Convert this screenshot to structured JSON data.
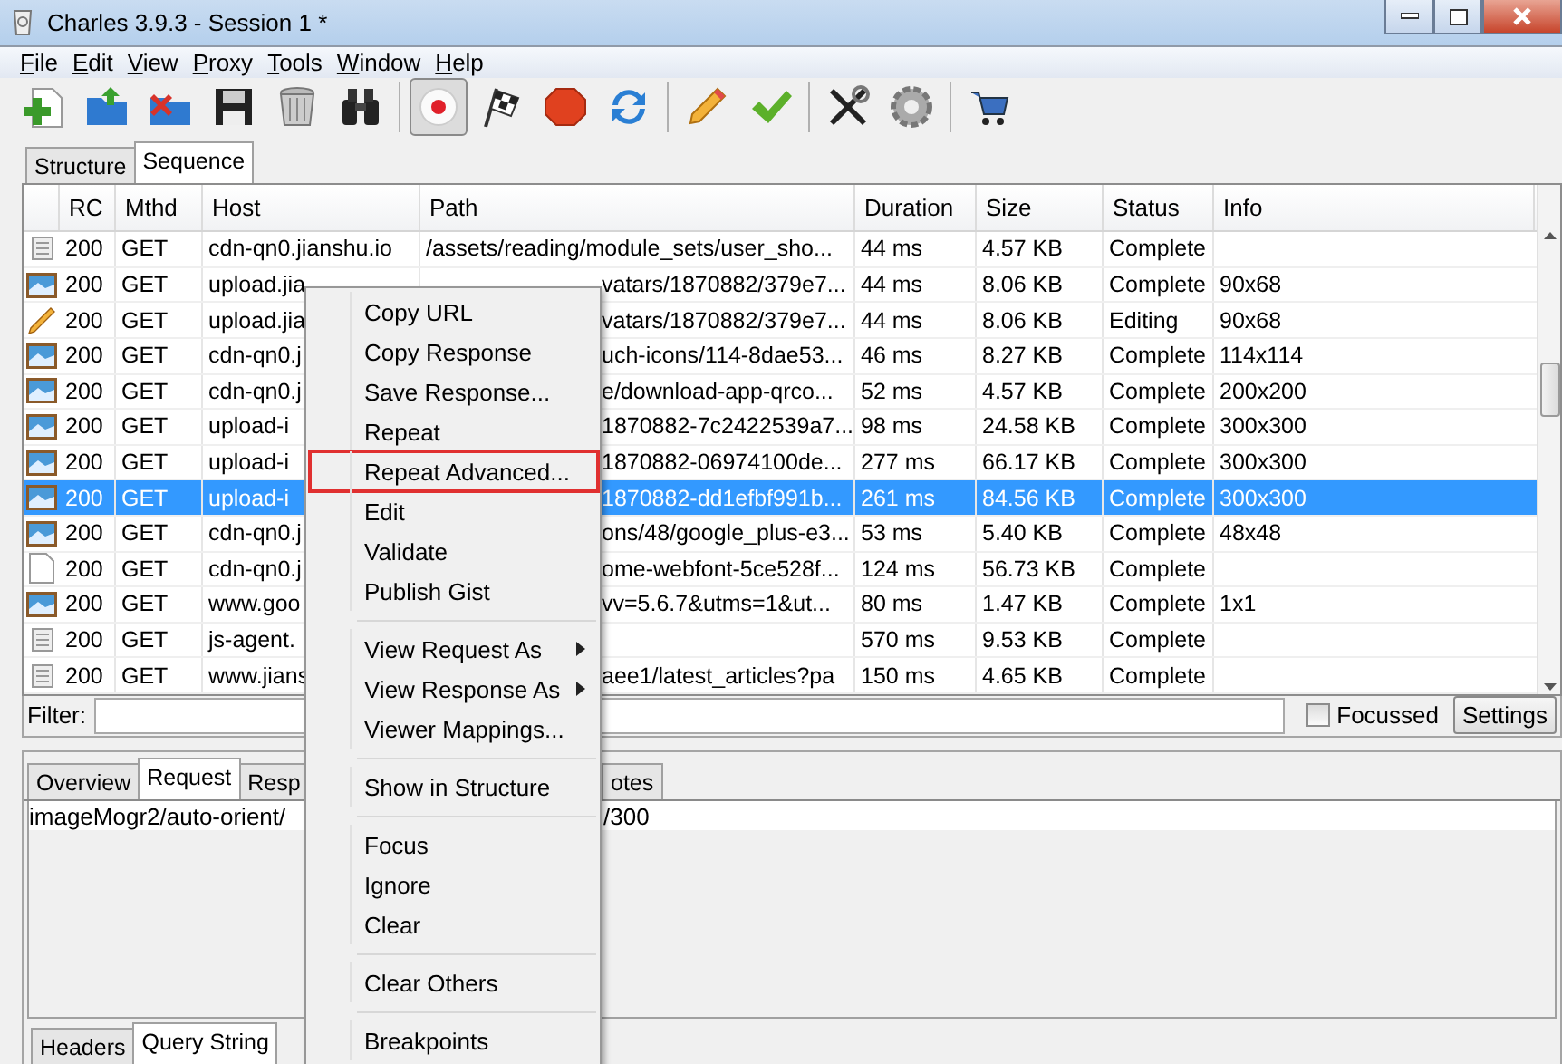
{
  "window": {
    "title": "Charles 3.9.3 - Session 1 *"
  },
  "menu_bar": [
    "File",
    "Edit",
    "View",
    "Proxy",
    "Tools",
    "Window",
    "Help"
  ],
  "toolbar": [
    {
      "kind": "new"
    },
    {
      "kind": "open"
    },
    {
      "kind": "close"
    },
    {
      "kind": "save"
    },
    {
      "kind": "trash"
    },
    {
      "kind": "find"
    },
    {
      "kind": "record",
      "pressed": true
    },
    {
      "kind": "flag",
      "pressed": false
    },
    {
      "kind": "stop",
      "pressed": false
    },
    {
      "kind": "repeat"
    },
    {
      "kind": "edit"
    },
    {
      "kind": "validate"
    },
    {
      "kind": "tools"
    },
    {
      "kind": "settings"
    },
    {
      "kind": "cart"
    }
  ],
  "view_tabs": [
    {
      "label": "Structure",
      "selected": false
    },
    {
      "label": "Sequence",
      "selected": true
    }
  ],
  "table": {
    "columns": [
      "RC",
      "Mthd",
      "Host",
      "Path",
      "Duration",
      "Size",
      "Status",
      "Info"
    ],
    "rows": [
      {
        "kind": "script",
        "rc": "200",
        "method": "GET",
        "host": "cdn-qn0.jianshu.io",
        "path": "/assets/reading/module_sets/user_sho...",
        "duration": "44 ms",
        "size": "4.57 KB",
        "status": "Complete",
        "info": "",
        "selected": false
      },
      {
        "kind": "image",
        "rc": "200",
        "method": "GET",
        "host": "upload.jia",
        "path": "vatars/1870882/379e7...",
        "duration": "44 ms",
        "size": "8.06 KB",
        "status": "Complete",
        "info": "90x68",
        "selected": false
      },
      {
        "kind": "edit",
        "rc": "200",
        "method": "GET",
        "host": "upload.jia",
        "path": "vatars/1870882/379e7...",
        "duration": "44 ms",
        "size": "8.06 KB",
        "status": "Editing",
        "info": "90x68",
        "selected": false
      },
      {
        "kind": "image",
        "rc": "200",
        "method": "GET",
        "host": "cdn-qn0.j",
        "path": "uch-icons/114-8dae53...",
        "duration": "46 ms",
        "size": "8.27 KB",
        "status": "Complete",
        "info": "114x114",
        "selected": false
      },
      {
        "kind": "image",
        "rc": "200",
        "method": "GET",
        "host": "cdn-qn0.j",
        "path": "e/download-app-qrco...",
        "duration": "52 ms",
        "size": "4.57 KB",
        "status": "Complete",
        "info": "200x200",
        "selected": false
      },
      {
        "kind": "image",
        "rc": "200",
        "method": "GET",
        "host": "upload-i",
        "path": "1870882-7c2422539a7...",
        "duration": "98 ms",
        "size": "24.58 KB",
        "status": "Complete",
        "info": "300x300",
        "selected": false
      },
      {
        "kind": "image",
        "rc": "200",
        "method": "GET",
        "host": "upload-i",
        "path": "1870882-06974100de...",
        "duration": "277 ms",
        "size": "66.17 KB",
        "status": "Complete",
        "info": "300x300",
        "selected": false
      },
      {
        "kind": "image",
        "rc": "200",
        "method": "GET",
        "host": "upload-i",
        "path": "1870882-dd1efbf991b...",
        "duration": "261 ms",
        "size": "84.56 KB",
        "status": "Complete",
        "info": "300x300",
        "selected": true
      },
      {
        "kind": "image",
        "rc": "200",
        "method": "GET",
        "host": "cdn-qn0.j",
        "path": "ons/48/google_plus-e3...",
        "duration": "53 ms",
        "size": "5.40 KB",
        "status": "Complete",
        "info": "48x48",
        "selected": false
      },
      {
        "kind": "document",
        "rc": "200",
        "method": "GET",
        "host": "cdn-qn0.j",
        "path": "ome-webfont-5ce528f...",
        "duration": "124 ms",
        "size": "56.73 KB",
        "status": "Complete",
        "info": "",
        "selected": false
      },
      {
        "kind": "image",
        "rc": "200",
        "method": "GET",
        "host": "www.goo",
        "path": "vv=5.6.7&utms=1&ut...",
        "duration": "80 ms",
        "size": "1.47 KB",
        "status": "Complete",
        "info": "1x1",
        "selected": false
      },
      {
        "kind": "script",
        "rc": "200",
        "method": "GET",
        "host": "js-agent.",
        "path": "",
        "duration": "570 ms",
        "size": "9.53 KB",
        "status": "Complete",
        "info": "",
        "selected": false
      },
      {
        "kind": "script",
        "rc": "200",
        "method": "GET",
        "host": "www.jians",
        "path": "aee1/latest_articles?pa",
        "duration": "150 ms",
        "size": "4.65 KB",
        "status": "Complete",
        "info": "",
        "selected": false
      }
    ]
  },
  "filter": {
    "label": "Filter:",
    "focussed": {
      "label": "Focussed",
      "checked": false
    },
    "settings_button": "Settings"
  },
  "detail_tabs": [
    {
      "label": "Overview",
      "selected": false
    },
    {
      "label": "Request",
      "selected": true
    },
    {
      "label": "Resp",
      "selected": false
    },
    {
      "label": "otes",
      "selected": false
    }
  ],
  "request_line": {
    "left": "imageMogr2/auto-orient/",
    "right": "/300"
  },
  "sub_tabs": [
    {
      "label": "Headers",
      "selected": false
    },
    {
      "label": "Query String",
      "selected": true
    }
  ],
  "context_menu": [
    {
      "kind": "item",
      "label": "Copy URL",
      "highlighted": false
    },
    {
      "kind": "item",
      "label": "Copy Response",
      "highlighted": false
    },
    {
      "kind": "item",
      "label": "Save Response...",
      "highlighted": false
    },
    {
      "kind": "item",
      "label": "Repeat",
      "highlighted": false
    },
    {
      "kind": "item",
      "label": "Repeat Advanced...",
      "highlighted": true
    },
    {
      "kind": "item",
      "label": "Edit",
      "highlighted": false
    },
    {
      "kind": "item",
      "label": "Validate",
      "highlighted": false
    },
    {
      "kind": "item",
      "label": "Publish Gist",
      "highlighted": false
    },
    {
      "kind": "separator"
    },
    {
      "kind": "submenu",
      "label": "View Request As",
      "highlighted": false
    },
    {
      "kind": "submenu",
      "label": "View Response As",
      "highlighted": false
    },
    {
      "kind": "item",
      "label": "Viewer Mappings...",
      "highlighted": false
    },
    {
      "kind": "separator"
    },
    {
      "kind": "item",
      "label": "Show in Structure",
      "highlighted": false
    },
    {
      "kind": "separator"
    },
    {
      "kind": "item",
      "label": "Focus",
      "highlighted": false
    },
    {
      "kind": "item",
      "label": "Ignore",
      "highlighted": false
    },
    {
      "kind": "item",
      "label": "Clear",
      "highlighted": false
    },
    {
      "kind": "separator"
    },
    {
      "kind": "item",
      "label": "Clear Others",
      "highlighted": false
    },
    {
      "kind": "separator"
    },
    {
      "kind": "item",
      "label": "Breakpoints",
      "highlighted": false
    }
  ]
}
